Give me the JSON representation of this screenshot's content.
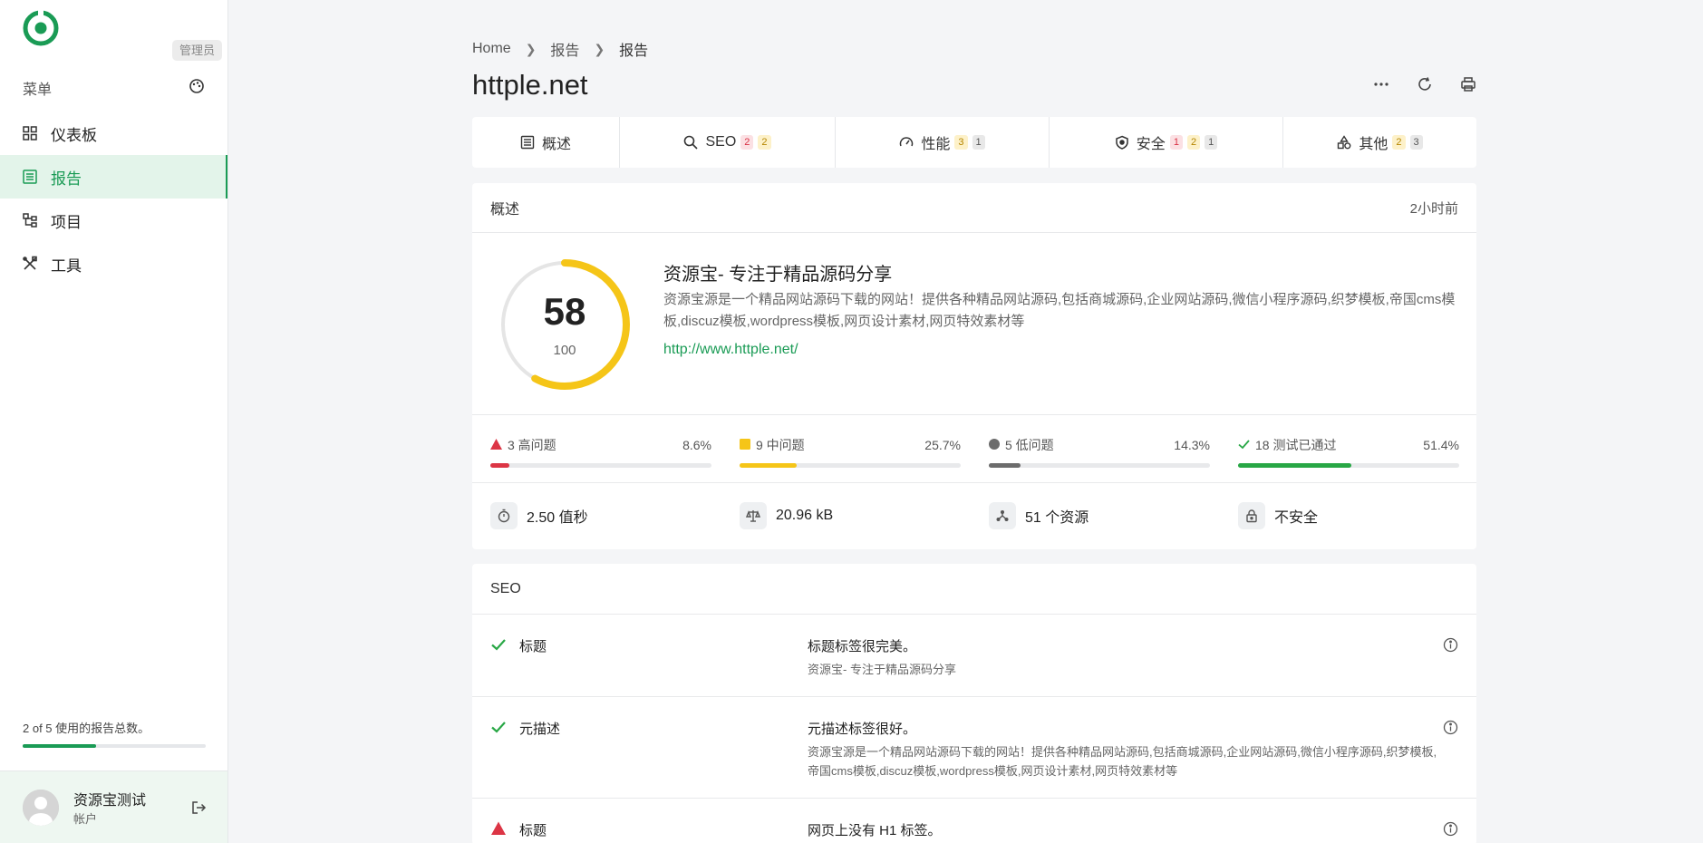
{
  "sidebar": {
    "tooltip": "管理员",
    "menu_label": "菜单",
    "items": [
      {
        "label": "仪表板",
        "icon": "dashboard-grid-icon"
      },
      {
        "label": "报告",
        "icon": "report-list-icon",
        "active": true
      },
      {
        "label": "项目",
        "icon": "project-tree-icon"
      },
      {
        "label": "工具",
        "icon": "tools-icon"
      }
    ],
    "usage_text": "2 of 5 使用的报告总数。",
    "usage_fraction": 0.4,
    "account": {
      "name": "资源宝测试",
      "sub": "帐户"
    }
  },
  "breadcrumb": [
    "Home",
    "报告",
    "报告"
  ],
  "page_title": "httple.net",
  "tabs": [
    {
      "label": "概述",
      "icon": "list-icon",
      "badges": []
    },
    {
      "label": "SEO",
      "icon": "search-icon",
      "badges": [
        {
          "v": "2",
          "c": "red"
        },
        {
          "v": "2",
          "c": "yellow"
        }
      ]
    },
    {
      "label": "性能",
      "icon": "speedometer-icon",
      "badges": [
        {
          "v": "3",
          "c": "yellow"
        },
        {
          "v": "1",
          "c": "gray"
        }
      ]
    },
    {
      "label": "安全",
      "icon": "shield-icon",
      "badges": [
        {
          "v": "1",
          "c": "red"
        },
        {
          "v": "2",
          "c": "yellow"
        },
        {
          "v": "1",
          "c": "gray"
        }
      ]
    },
    {
      "label": "其他",
      "icon": "shapes-icon",
      "badges": [
        {
          "v": "2",
          "c": "yellow"
        },
        {
          "v": "3",
          "c": "gray"
        }
      ]
    }
  ],
  "overview": {
    "heading": "概述",
    "time": "2小时前",
    "score": "58",
    "score_max": "100",
    "score_fraction": 0.58,
    "site_title": "资源宝- 专注于精品源码分享",
    "site_desc": "资源宝源是一个精品网站源码下载的网站！提供各种精品网站源码,包括商城源码,企业网站源码,微信小程序源码,织梦模板,帝国cms模板,discuz模板,wordpress模板,网页设计素材,网页特效素材等",
    "site_url": "http://www.httple.net/",
    "stats": [
      {
        "label": "3 高问题",
        "pct": "8.6%",
        "fraction": 0.086,
        "color": "#dc3545"
      },
      {
        "label": "9 中问题",
        "pct": "25.7%",
        "fraction": 0.257,
        "color": "#f5c518"
      },
      {
        "label": "5 低问题",
        "pct": "14.3%",
        "fraction": 0.143,
        "color": "#6c6c6c"
      },
      {
        "label": "18 测试已通过",
        "pct": "51.4%",
        "fraction": 0.514,
        "color": "#28a745"
      }
    ],
    "meta": [
      {
        "value": "2.50 值秒",
        "icon": "stopwatch-icon"
      },
      {
        "value": "20.96 kB",
        "icon": "scale-icon"
      },
      {
        "value": "51 个资源",
        "icon": "network-icon"
      },
      {
        "value": "不安全",
        "icon": "lock-icon"
      }
    ]
  },
  "seo": {
    "heading": "SEO",
    "rows": [
      {
        "status": "pass",
        "name": "标题",
        "message": "标题标签很完美。",
        "detail": "资源宝- 专注于精品源码分享"
      },
      {
        "status": "pass",
        "name": "元描述",
        "message": "元描述标签很好。",
        "detail": "资源宝源是一个精品网站源码下载的网站！提供各种精品网站源码,包括商城源码,企业网站源码,微信小程序源码,织梦模板,帝国cms模板,discuz模板,wordpress模板,网页设计素材,网页特效素材等"
      },
      {
        "status": "fail",
        "name": "标题",
        "message": "网页上没有 H1 标签。",
        "detail": ""
      }
    ]
  },
  "colors": {
    "accent": "#1a9b55",
    "score_ring": "#f5c518"
  }
}
